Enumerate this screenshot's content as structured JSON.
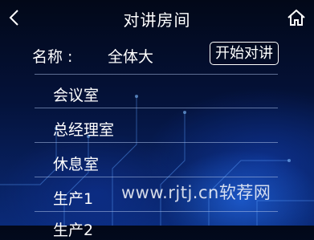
{
  "header": {
    "title": "对讲房间",
    "back_icon": "chevron-left-icon",
    "home_icon": "home-icon"
  },
  "room": {
    "name_label": "名称 :",
    "name_value": "全体大",
    "start_button_label": "开始对讲"
  },
  "rooms": [
    {
      "label": "会议室"
    },
    {
      "label": "总经理室"
    },
    {
      "label": "休息室"
    },
    {
      "label": "生产1"
    },
    {
      "label": "生产2"
    }
  ],
  "watermark": "www.rjtj.cn软荐网",
  "colors": {
    "text": "#ffffff",
    "background_top": "#020818",
    "background_bottom": "#0a2a78",
    "divider": "#aabee6"
  }
}
